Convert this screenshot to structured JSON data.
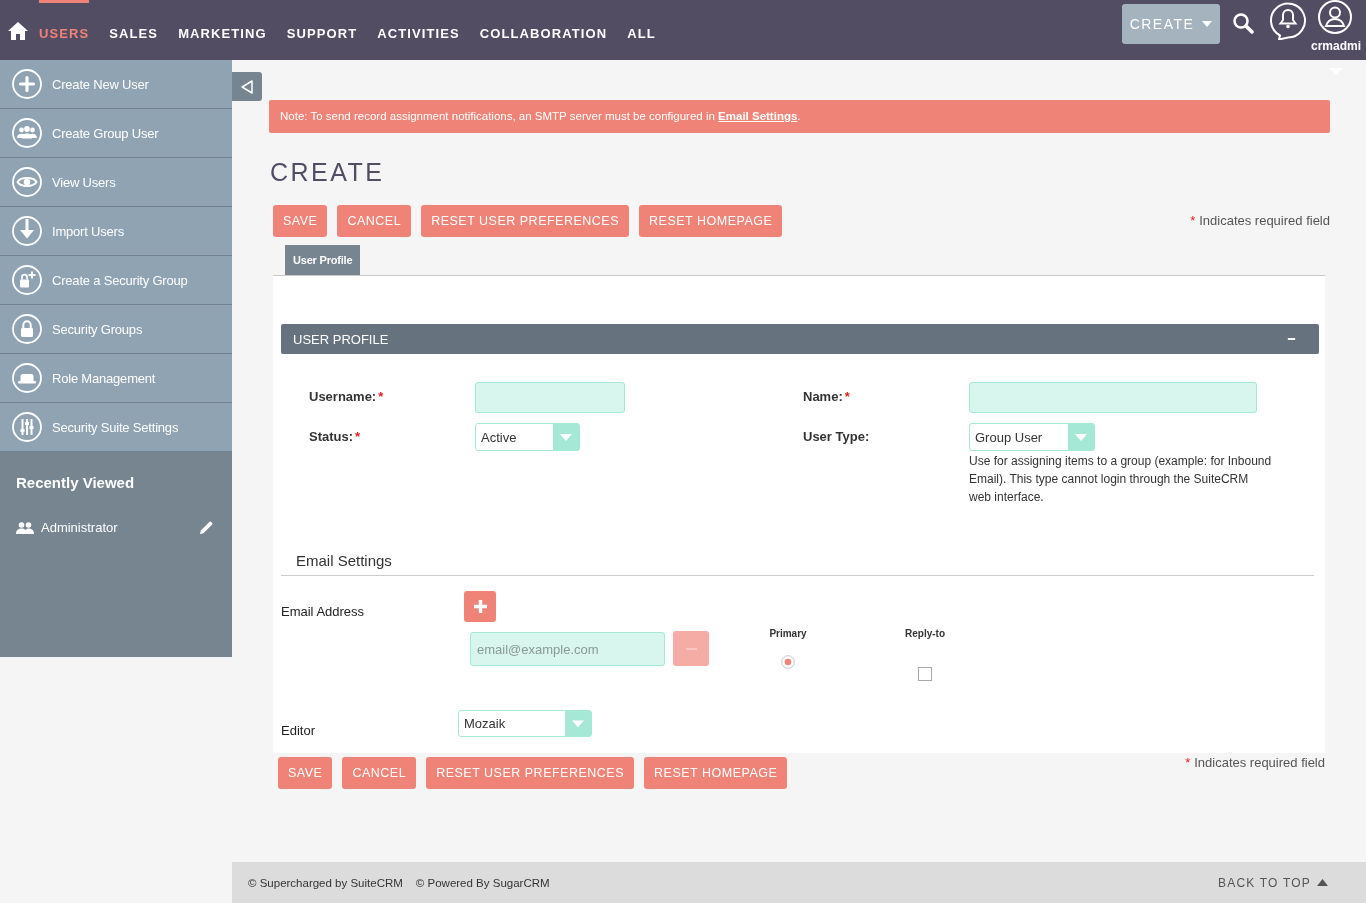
{
  "nav": {
    "items": [
      {
        "label": "USERS",
        "selected": true
      },
      {
        "label": "SALES",
        "selected": false
      },
      {
        "label": "MARKETING",
        "selected": false
      },
      {
        "label": "SUPPORT",
        "selected": false
      },
      {
        "label": "ACTIVITIES",
        "selected": false
      },
      {
        "label": "COLLABORATION",
        "selected": false
      },
      {
        "label": "ALL",
        "selected": false
      }
    ],
    "create_button": "CREATE",
    "user_name": "crmadmi"
  },
  "sidebar": {
    "actions": [
      {
        "label": "Create New User"
      },
      {
        "label": "Create Group User"
      },
      {
        "label": "View Users"
      },
      {
        "label": "Import Users"
      },
      {
        "label": "Create a Security Group"
      },
      {
        "label": "Security Groups"
      },
      {
        "label": "Role Management"
      },
      {
        "label": "Security Suite Settings"
      }
    ],
    "recently_viewed": {
      "title": "Recently Viewed",
      "items": [
        {
          "label": "Administrator"
        }
      ]
    }
  },
  "alert": {
    "text": "Note: To send record assignment notifications, an SMTP server must be configured in",
    "link": "Email Settings",
    "text_after": "."
  },
  "page_title": "CREATE",
  "top_actions": {
    "buttons": [
      "SAVE",
      "CANCEL",
      "RESET USER PREFERENCES",
      "RESET HOMEPAGE"
    ],
    "required_mark": "*",
    "required_note": "Indicates required field"
  },
  "tabs": [
    {
      "label": "User Profile",
      "selected": true
    }
  ],
  "user_profile_panel": {
    "title": "USER PROFILE",
    "expanded": true,
    "fields": [
      {
        "label": "Username:",
        "required_mark": "*",
        "kind": "text"
      },
      {
        "label": "Name:",
        "required_mark": "*",
        "kind": "text"
      },
      {
        "label": "Status:",
        "required_mark": "*",
        "kind": "select",
        "value": "Active"
      },
      {
        "label": "User Type:",
        "kind": "select",
        "value": "Group User",
        "help": "Use for assigning items to a group (example: for Inbound Email). This type cannot login through the SuiteCRM web interface."
      }
    ]
  },
  "email_settings": {
    "title": "Email Settings",
    "address_label": "Email Address",
    "placeholder": "email@example.com",
    "remove_disabled": true,
    "primary_label": "Primary",
    "primary": true,
    "reply_to_label": "Reply-to",
    "reply_to": false,
    "editor_label": "Editor",
    "editor_value": "Mozaik"
  },
  "bottom_actions": {
    "buttons": [
      "SAVE",
      "CANCEL",
      "RESET USER PREFERENCES",
      "RESET HOMEPAGE"
    ],
    "required_mark": "*",
    "required_note": "Indicates required field"
  },
  "footer": {
    "credits": [
      "© Supercharged by SuiteCRM",
      "© Powered By SugarCRM"
    ],
    "back_to_top": "BACK TO TOP"
  }
}
